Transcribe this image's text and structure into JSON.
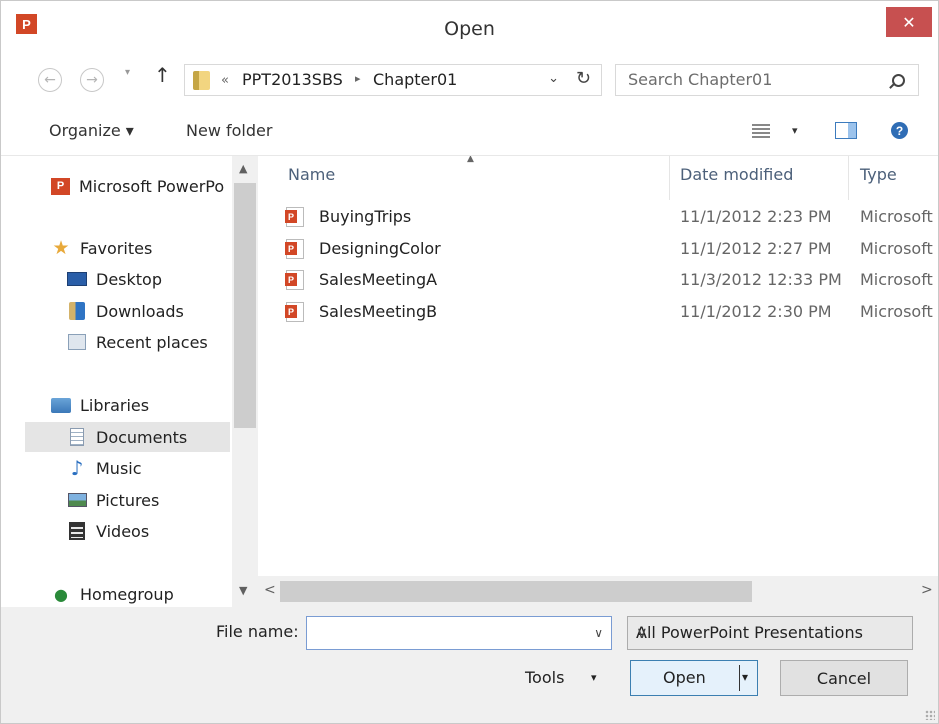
{
  "window": {
    "title": "Open",
    "app_icon": "P",
    "close": "✕"
  },
  "nav": {
    "back": "←",
    "forward": "→",
    "recent": "▾",
    "up": "↑",
    "breadcrumb_overflow": "«",
    "breadcrumb": [
      "PPT2013SBS",
      "Chapter01"
    ],
    "breadcrumb_sep": "▸",
    "dropdown": "⌄",
    "refresh": "↻"
  },
  "search": {
    "placeholder": "Search Chapter01"
  },
  "toolbar": {
    "organize": "Organize ▾",
    "new_folder": "New folder",
    "views_dropdown": "▾",
    "help": "?"
  },
  "navpane": {
    "items": [
      {
        "label": "Microsoft PowerPo",
        "icon": "powerpoint-icon"
      },
      {
        "label": "Favorites",
        "icon": "star-icon"
      },
      {
        "label": "Desktop",
        "icon": "desktop-icon"
      },
      {
        "label": "Downloads",
        "icon": "downloads-icon"
      },
      {
        "label": "Recent places",
        "icon": "recent-places-icon"
      },
      {
        "label": "Libraries",
        "icon": "libraries-icon"
      },
      {
        "label": "Documents",
        "icon": "documents-icon",
        "selected": true
      },
      {
        "label": "Music",
        "icon": "music-icon"
      },
      {
        "label": "Pictures",
        "icon": "pictures-icon"
      },
      {
        "label": "Videos",
        "icon": "videos-icon"
      },
      {
        "label": "Homegroup",
        "icon": "homegroup-icon"
      }
    ],
    "scroll_up": "▲",
    "scroll_down": "▼"
  },
  "files": {
    "columns": [
      "Name",
      "Date modified",
      "Type"
    ],
    "sort_indicator": "▲",
    "rows": [
      {
        "name": "BuyingTrips",
        "date": "11/1/2012 2:23 PM",
        "type": "Microsoft"
      },
      {
        "name": "DesigningColor",
        "date": "11/1/2012 2:27 PM",
        "type": "Microsoft"
      },
      {
        "name": "SalesMeetingA",
        "date": "11/3/2012 12:33 PM",
        "type": "Microsoft"
      },
      {
        "name": "SalesMeetingB",
        "date": "11/1/2012 2:30 PM",
        "type": "Microsoft"
      }
    ],
    "scroll_left": "<",
    "scroll_right": ">"
  },
  "bottom": {
    "file_name_label": "File name:",
    "file_name_value": "",
    "dropdown": "∨",
    "file_type": "All PowerPoint Presentations",
    "tools": "Tools",
    "tools_dropdown": "▾",
    "open": "Open",
    "open_dropdown": "▾",
    "cancel": "Cancel"
  },
  "colors": {
    "powerpoint": "#d24726",
    "close_button": "#c75050",
    "selection": "#e5e5e5",
    "column_header": "#4c607a"
  }
}
